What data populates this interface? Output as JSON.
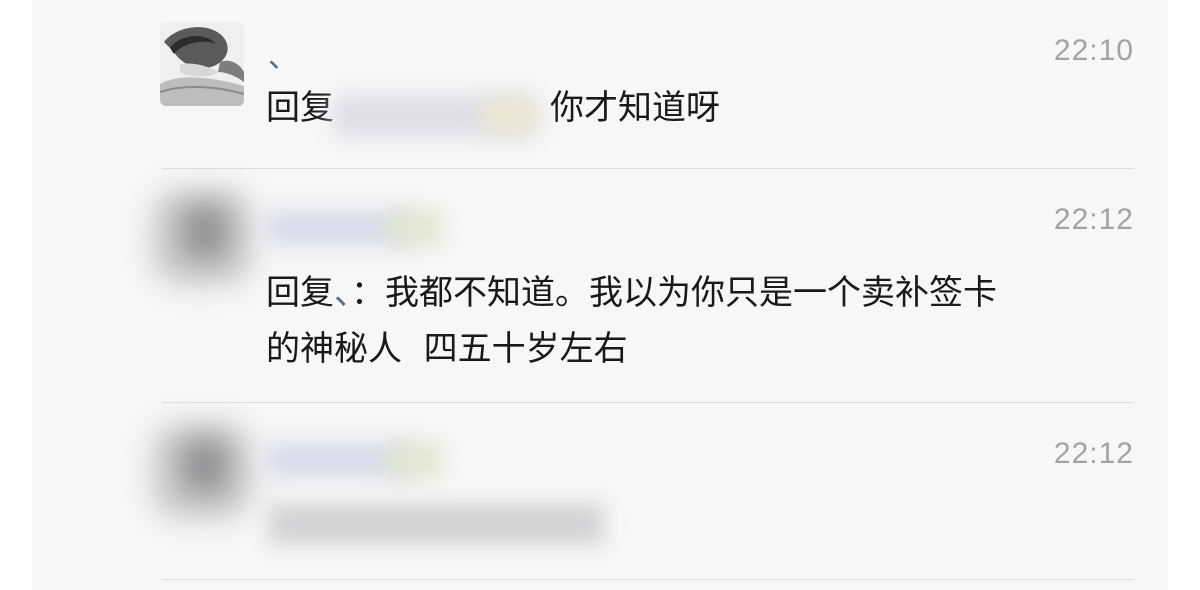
{
  "comments": [
    {
      "author": "、",
      "time": "22:10",
      "reply_prefix": "回复",
      "message": "你才知道呀"
    },
    {
      "time": "22:12",
      "reply_prefix": "回复",
      "reply_to": "、",
      "separator": "：",
      "message_line1": "我都不知道。我以为你只是一个卖补签卡",
      "message_line2": "的神秘人  四五十岁左右"
    },
    {
      "time": "22:12"
    }
  ],
  "colors": {
    "panel_bg": "#f7f7f7",
    "link": "#576b95",
    "time": "#a3a3a3",
    "text": "#191919",
    "divider": "#dedede"
  }
}
